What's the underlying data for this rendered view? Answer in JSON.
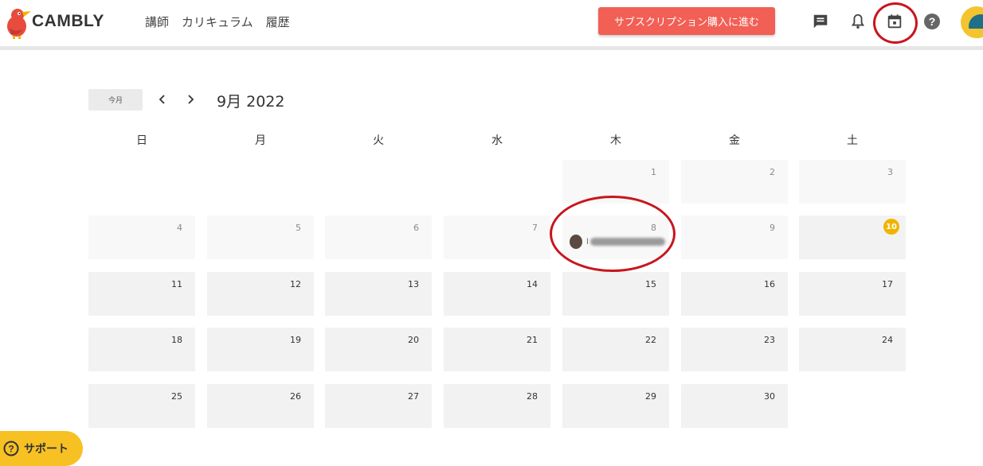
{
  "app": {
    "brand": "CAMBLY"
  },
  "nav": {
    "items": [
      "講師",
      "カリキュラム",
      "履歴"
    ]
  },
  "header": {
    "subscribe_label": "サブスクリプション購入に進む",
    "icons": [
      "chat-icon",
      "bell-icon",
      "calendar-icon",
      "help-icon"
    ]
  },
  "calendar": {
    "today_label": "今月",
    "month_label": "9月 2022",
    "weekdays": [
      "日",
      "月",
      "火",
      "水",
      "木",
      "金",
      "土"
    ],
    "today": 10,
    "lesson": {
      "day": 8,
      "tutor_name_visible": "l"
    }
  },
  "support": {
    "label": "サポート"
  },
  "colors": {
    "accent": "#f25f55",
    "highlight": "#c8151d",
    "today_badge": "#f0b400",
    "support": "#f7c123"
  }
}
